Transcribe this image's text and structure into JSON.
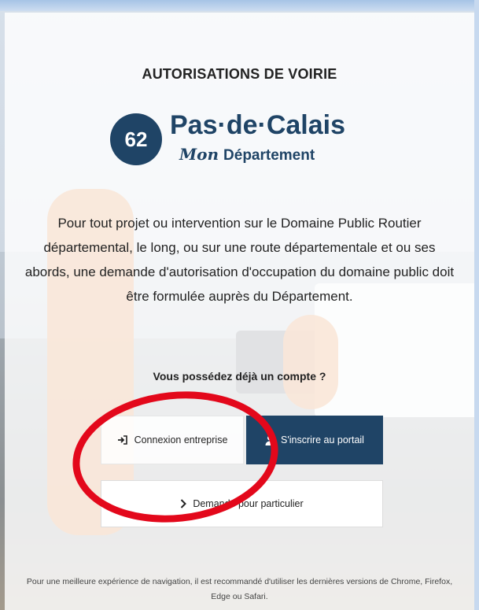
{
  "header": {
    "title": "AUTORISATIONS DE VOIRIE"
  },
  "logo": {
    "number": "62",
    "name": "Pas·de·Calais",
    "sub_mon": "Mon",
    "sub_departement": "Département"
  },
  "intro": {
    "text": "Pour tout projet ou intervention sur le Domaine Public Routier départemental, le long, ou sur une route départementale et ou ses abords, une demande d'autorisation d'occupation du domaine public doit être formulée auprès du Département."
  },
  "account": {
    "question": "Vous possédez déjà un compte ?",
    "login_label": "Connexion entreprise",
    "login_icon": "sign-in-icon",
    "signup_label": "S'inscrire au portail",
    "signup_icon": "user-icon",
    "private_label": "Demande pour particulier",
    "private_icon": "chevron-right-icon"
  },
  "footer": {
    "note": "Pour une meilleure expérience de navigation, il est recommandé d'utiliser les dernières versions de Chrome, Firefox, Edge ou Safari."
  },
  "colors": {
    "brand": "#1f4466",
    "highlight": "#e3081b"
  }
}
